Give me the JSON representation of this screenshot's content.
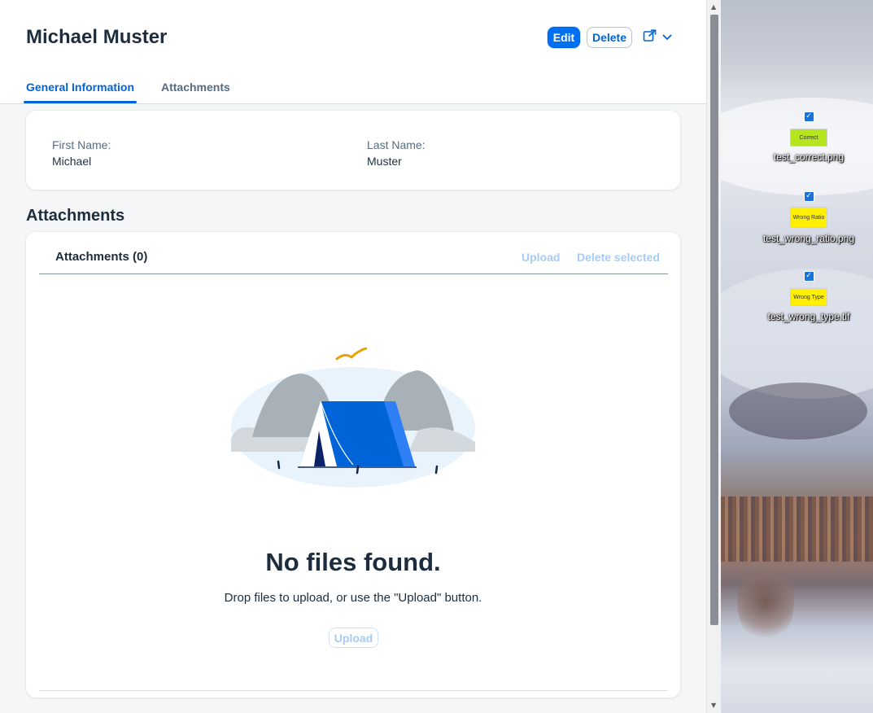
{
  "header": {
    "title": "Michael Muster",
    "edit_label": "Edit",
    "delete_label": "Delete",
    "share_icon": "share-icon",
    "dropdown_icon": "chevron-down-icon"
  },
  "tabs": [
    {
      "label": "General Information",
      "active": true
    },
    {
      "label": "Attachments",
      "active": false
    }
  ],
  "general_info": {
    "first_name_label": "First Name:",
    "first_name_value": "Michael",
    "last_name_label": "Last Name:",
    "last_name_value": "Muster"
  },
  "attachments_section": {
    "section_title": "Attachments",
    "toolbar_title": "Attachments (0)",
    "upload_label": "Upload",
    "delete_selected_label": "Delete selected",
    "empty_title": "No files found.",
    "empty_description": "Drop files to upload, or use the \"Upload\" button.",
    "empty_upload_label": "Upload"
  },
  "desktop_icons": [
    {
      "filename": "test_correct.png",
      "thumb_text": "Correct",
      "thumb_color": "#b5e61d",
      "checked": true
    },
    {
      "filename": "test_wrong_ratio.png",
      "thumb_text": "Wrong Ratio",
      "thumb_color": "#ffef00",
      "checked": true
    },
    {
      "filename": "test_wrong_type.tif",
      "thumb_text": "Wrong Type",
      "thumb_color": "#ffef00",
      "checked": true
    }
  ],
  "colors": {
    "accent": "#0070f2",
    "link_disabled": "#a8cbf3",
    "text": "#1d2d3e",
    "label": "#556b82"
  }
}
